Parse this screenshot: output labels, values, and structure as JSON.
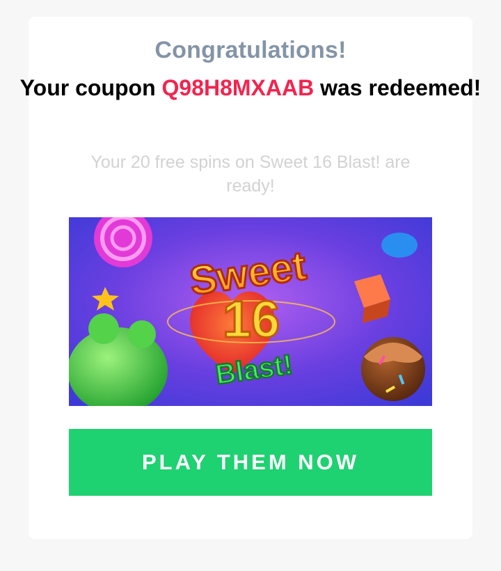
{
  "colors": {
    "page_background": "#f7f7f7",
    "card_background": "#ffffff",
    "congrats_text": "#8494a7",
    "coupon_code": "#f2244f",
    "subtext": "#d2d2d2",
    "play_button": "#1ed171"
  },
  "message": {
    "congrats": "Congratulations!",
    "line_prefix": "Your coupon ",
    "coupon_code": "Q98H8MXAAB",
    "line_suffix": " was redeemed!",
    "subtext": "Your 20 free spins on Sweet 16 Blast! are ready!"
  },
  "banner": {
    "game_title_word": "Sweet",
    "game_title_number": "16",
    "game_title_tag": "Blast!"
  },
  "cta": {
    "label": "PLAY THEM NOW"
  }
}
